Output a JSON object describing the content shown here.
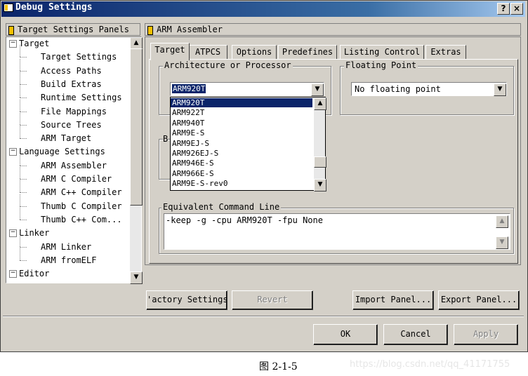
{
  "window": {
    "title": "Debug Settings",
    "help_btn": "?",
    "close_btn": "×"
  },
  "left_panel": {
    "header": "Target Settings Panels",
    "tree": [
      {
        "label": "Target",
        "level": 0,
        "expander": "−"
      },
      {
        "label": "Target Settings",
        "level": 1
      },
      {
        "label": "Access Paths",
        "level": 1
      },
      {
        "label": "Build Extras",
        "level": 1
      },
      {
        "label": "Runtime Settings",
        "level": 1
      },
      {
        "label": "File Mappings",
        "level": 1
      },
      {
        "label": "Source Trees",
        "level": 1
      },
      {
        "label": "ARM Target",
        "level": 1
      },
      {
        "label": "Language Settings",
        "level": 0,
        "expander": "−"
      },
      {
        "label": "ARM Assembler",
        "level": 1
      },
      {
        "label": "ARM C Compiler",
        "level": 1
      },
      {
        "label": "ARM C++ Compiler",
        "level": 1
      },
      {
        "label": "Thumb C Compiler",
        "level": 1
      },
      {
        "label": "Thumb C++ Com...",
        "level": 1
      },
      {
        "label": "Linker",
        "level": 0,
        "expander": "−"
      },
      {
        "label": "ARM Linker",
        "level": 1
      },
      {
        "label": "ARM fromELF",
        "level": 1
      },
      {
        "label": "Editor",
        "level": 0,
        "expander": "−"
      }
    ]
  },
  "right_panel": {
    "header": "ARM Assembler",
    "tabs": [
      "Target",
      "ATPCS",
      "Options",
      "Predefines",
      "Listing Control",
      "Extras"
    ],
    "active_tab": "Target",
    "arch_group": {
      "label": "Architecture or Processor",
      "selected": "ARM920T",
      "options": [
        "ARM920T",
        "ARM922T",
        "ARM940T",
        "ARM9E-S",
        "ARM9EJ-S",
        "ARM926EJ-S",
        "ARM946E-S",
        "ARM966E-S",
        "ARM9E-S-rev0"
      ]
    },
    "float_group": {
      "label": "Floating Point",
      "selected": "No floating point"
    },
    "hidden_group_letter": "B",
    "cmd_group": {
      "label": "Equivalent Command Line",
      "value": "-keep -g -cpu ARM920T -fpu None"
    }
  },
  "buttons": {
    "factory": "'actory Settings",
    "revert": "Revert",
    "import": "Import Panel...",
    "export": "Export Panel...",
    "ok": "OK",
    "cancel": "Cancel",
    "apply": "Apply"
  },
  "caption": "图 2-1-5",
  "watermark": "https://blog.csdn.net/qq_41171755"
}
